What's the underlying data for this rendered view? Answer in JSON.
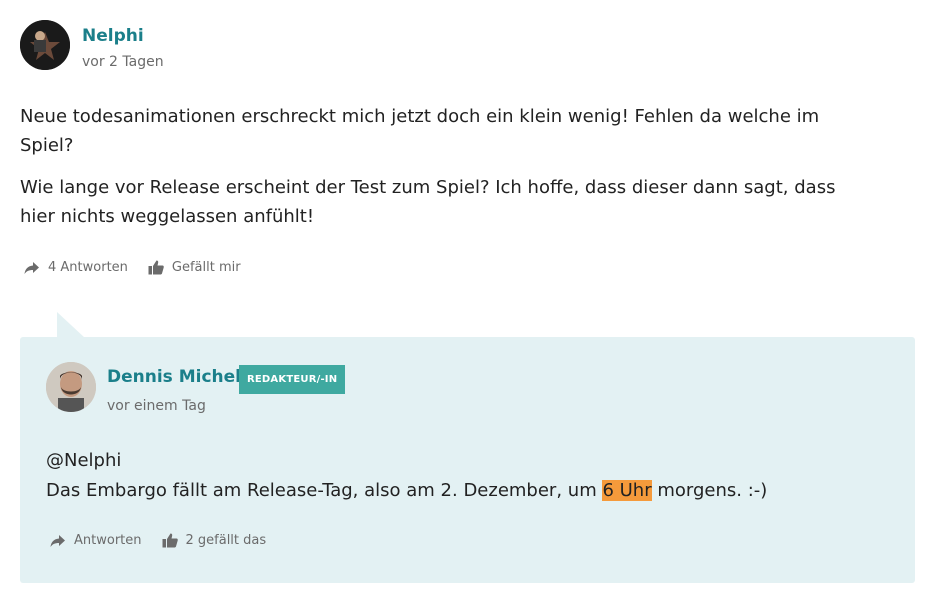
{
  "comment": {
    "author": "Nelphi",
    "time": "vor 2 Tagen",
    "paragraphs": [
      "Neue todesanimationen erschreckt mich jetzt doch ein klein wenig! Fehlen da welche im Spiel?",
      "Wie lange vor Release erscheint der Test zum Spiel? Ich hoffe, dass dieser dann sagt, dass hier nichts weggelassen anfühlt!"
    ],
    "reply_action": "4 Antworten",
    "like_action": "Gefällt mir"
  },
  "reply": {
    "author": "Dennis Michel",
    "badge": "REDAKTEUR/-IN",
    "time": "vor einem Tag",
    "line1": "@Nelphi",
    "line2_before": "Das Embargo fällt am Release-Tag, also am 2. Dezember, um ",
    "line2_highlight": "6 Uhr",
    "line2_after": " morgens. :-)",
    "reply_action": "Antworten",
    "like_action": "2 gefällt das"
  },
  "colors": {
    "author": "#1b7f8a",
    "badge": "#3fa9a0",
    "reply_bg": "#e3f1f3",
    "highlight": "#f59a3b"
  },
  "icons": [
    "share-arrow-icon",
    "thumbs-up-icon"
  ]
}
